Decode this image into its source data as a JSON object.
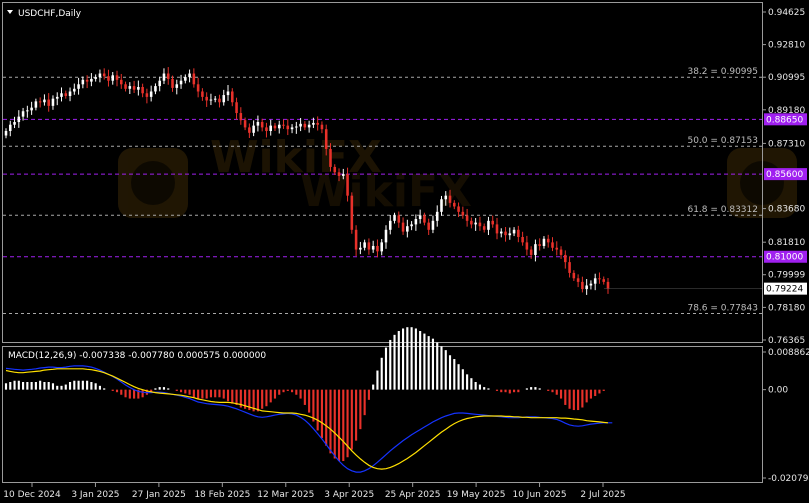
{
  "window": {
    "title": "USDCHF,Daily",
    "watermark_text": "WikiFX"
  },
  "colors": {
    "background": "#000000",
    "frame": "#9a9a9a",
    "bull": "#ffffff",
    "bear": "#e8312a",
    "fib_line": "#a8a8a8",
    "level_line": "#a020f0",
    "macd_signal": "#ffe000",
    "macd_line": "#1533ff",
    "hist_pos": "#ffffff",
    "hist_neg": "#e8312a"
  },
  "chart_data": [
    {
      "type": "candlestick",
      "symbol": "USDCHF",
      "timeframe": "Daily",
      "title": "USDCHF,Daily",
      "ylim": [
        0.76365,
        0.94625
      ],
      "y_ticks": [
        "0.94625",
        "0.92810",
        "0.90995",
        "0.89180",
        "0.88650",
        "0.87310",
        "0.85600",
        "0.83680",
        "0.81810",
        "0.81000",
        "0.79999",
        "0.79224",
        "0.78180",
        "0.76365"
      ],
      "x_ticks": [
        "10 Dec 2024",
        "3 Jan 2025",
        "27 Jan 2025",
        "18 Feb 2025",
        "12 Mar 2025",
        "3 Apr 2025",
        "25 Apr 2025",
        "19 May 2025",
        "10 Jun 2025",
        "2 Jul 2025"
      ],
      "fibonacci": [
        {
          "label": "38.2 = 0.90995",
          "value": 0.90995
        },
        {
          "label": "50.0 = 0.87153",
          "value": 0.87153
        },
        {
          "label": "61.8 = 0.83312",
          "value": 0.83312
        },
        {
          "label": "78.6 = 0.77843",
          "value": 0.77843
        }
      ],
      "levels": [
        {
          "label": "0.88650",
          "value": 0.8865
        },
        {
          "label": "0.85600",
          "value": 0.856
        },
        {
          "label": "0.81000",
          "value": 0.81
        }
      ],
      "last_price": {
        "label": "0.79224",
        "value": 0.79224
      },
      "closes": [
        0.88,
        0.8835,
        0.885,
        0.888,
        0.891,
        0.8915,
        0.893,
        0.8965,
        0.896,
        0.8975,
        0.894,
        0.898,
        0.899,
        0.901,
        0.8995,
        0.902,
        0.9035,
        0.906,
        0.9085,
        0.9075,
        0.909,
        0.91,
        0.912,
        0.9105,
        0.908,
        0.911,
        0.9085,
        0.906,
        0.9035,
        0.905,
        0.903,
        0.9045,
        0.901,
        0.899,
        0.902,
        0.905,
        0.908,
        0.912,
        0.909,
        0.904,
        0.906,
        0.908,
        0.91,
        0.912,
        0.906,
        0.902,
        0.899,
        0.897,
        0.8975,
        0.898,
        0.896,
        0.9,
        0.902,
        0.896,
        0.89,
        0.886,
        0.882,
        0.879,
        0.883,
        0.885,
        0.882,
        0.88,
        0.883,
        0.8815,
        0.8835,
        0.883,
        0.881,
        0.882,
        0.8825,
        0.884,
        0.882,
        0.8835,
        0.8845,
        0.8835,
        0.881,
        0.87,
        0.86,
        0.857,
        0.855,
        0.856,
        0.844,
        0.825,
        0.814,
        0.815,
        0.818,
        0.814,
        0.816,
        0.813,
        0.818,
        0.825,
        0.83,
        0.833,
        0.829,
        0.824,
        0.827,
        0.828,
        0.831,
        0.833,
        0.829,
        0.825,
        0.83,
        0.835,
        0.842,
        0.844,
        0.84,
        0.838,
        0.835,
        0.833,
        0.83,
        0.828,
        0.829,
        0.827,
        0.825,
        0.83,
        0.828,
        0.823,
        0.824,
        0.822,
        0.823,
        0.825,
        0.821,
        0.818,
        0.814,
        0.811,
        0.817,
        0.816,
        0.82,
        0.818,
        0.815,
        0.814,
        0.811,
        0.807,
        0.801,
        0.798,
        0.796,
        0.792,
        0.794,
        0.795,
        0.798,
        0.7975,
        0.796,
        0.7922
      ],
      "macd_header": "MACD(12,26,9) -0.007338 -0.007780 0.000575 0.000000",
      "macd_ylim": [
        -0.020794,
        0.008862
      ],
      "macd_y_ticks": [
        "0.008862",
        "0.00",
        "-0.020794"
      ],
      "macd_signal": [
        0.0045,
        0.0043,
        0.0041,
        0.004,
        0.004,
        0.0041,
        0.0042,
        0.0043,
        0.0044,
        0.0046,
        0.0047,
        0.0048,
        0.0049,
        0.0049,
        0.0049,
        0.0049,
        0.0049,
        0.0049,
        0.0049,
        0.0048,
        0.0047,
        0.0045,
        0.0043,
        0.004,
        0.0036,
        0.0032,
        0.0027,
        0.0022,
        0.0017,
        0.0012,
        0.0007,
        0.0003,
        0.0,
        -0.0003,
        -0.0005,
        -0.0007,
        -0.0008,
        -0.0009,
        -0.001,
        -0.0011,
        -0.0012,
        -0.0013,
        -0.0015,
        -0.0017,
        -0.0019,
        -0.0022,
        -0.0024,
        -0.0026,
        -0.0028,
        -0.0029,
        -0.003,
        -0.003,
        -0.003,
        -0.0031,
        -0.0033,
        -0.0035,
        -0.0038,
        -0.0041,
        -0.0044,
        -0.0047,
        -0.005,
        -0.0051,
        -0.0052,
        -0.0053,
        -0.0054,
        -0.0055,
        -0.0055,
        -0.0055,
        -0.0056,
        -0.0058,
        -0.006,
        -0.0063,
        -0.0067,
        -0.0072,
        -0.0078,
        -0.0085,
        -0.0093,
        -0.0102,
        -0.0112,
        -0.0122,
        -0.0133,
        -0.0144,
        -0.0154,
        -0.0163,
        -0.0171,
        -0.0178,
        -0.0183,
        -0.0186,
        -0.0187,
        -0.0186,
        -0.0183,
        -0.0179,
        -0.0174,
        -0.0168,
        -0.0162,
        -0.0155,
        -0.0148,
        -0.014,
        -0.0132,
        -0.0124,
        -0.0116,
        -0.0108,
        -0.01,
        -0.0093,
        -0.0086,
        -0.008,
        -0.0075,
        -0.0071,
        -0.0068,
        -0.0066,
        -0.0064,
        -0.0063,
        -0.0062,
        -0.0062,
        -0.0062,
        -0.0062,
        -0.0062,
        -0.0063,
        -0.0063,
        -0.0064,
        -0.0064,
        -0.0065,
        -0.0065,
        -0.0066,
        -0.0066,
        -0.0066,
        -0.0066,
        -0.0066,
        -0.0066,
        -0.0066,
        -0.0067,
        -0.0067,
        -0.0068,
        -0.0069,
        -0.007,
        -0.0071,
        -0.0073,
        -0.0074,
        -0.0075,
        -0.0076,
        -0.0077,
        -0.0078
      ],
      "macd_line": [
        0.005,
        0.0049,
        0.0048,
        0.0047,
        0.0046,
        0.0047,
        0.0048,
        0.0049,
        0.0051,
        0.0052,
        0.0053,
        0.0053,
        0.0052,
        0.0052,
        0.0053,
        0.0055,
        0.0056,
        0.0056,
        0.0056,
        0.0055,
        0.0053,
        0.005,
        0.0046,
        0.0041,
        0.0036,
        0.0031,
        0.0025,
        0.0018,
        0.0011,
        0.0005,
        0.0,
        -0.0004,
        -0.0006,
        -0.0007,
        -0.0007,
        -0.0006,
        -0.0006,
        -0.0007,
        -0.0009,
        -0.0011,
        -0.0013,
        -0.0015,
        -0.0018,
        -0.0021,
        -0.0025,
        -0.0029,
        -0.0031,
        -0.0033,
        -0.0034,
        -0.0035,
        -0.0036,
        -0.0037,
        -0.0039,
        -0.0042,
        -0.0045,
        -0.0049,
        -0.0053,
        -0.0057,
        -0.0061,
        -0.0064,
        -0.0065,
        -0.0064,
        -0.0062,
        -0.006,
        -0.0058,
        -0.0057,
        -0.0056,
        -0.0057,
        -0.006,
        -0.0065,
        -0.0072,
        -0.0081,
        -0.0092,
        -0.0104,
        -0.0116,
        -0.0129,
        -0.0143,
        -0.0156,
        -0.0168,
        -0.0178,
        -0.0186,
        -0.0191,
        -0.0194,
        -0.0194,
        -0.0191,
        -0.0186,
        -0.0179,
        -0.0171,
        -0.0162,
        -0.0153,
        -0.0144,
        -0.0136,
        -0.0128,
        -0.012,
        -0.0113,
        -0.0106,
        -0.01,
        -0.0094,
        -0.0088,
        -0.0082,
        -0.0076,
        -0.0071,
        -0.0066,
        -0.0062,
        -0.0059,
        -0.0056,
        -0.0055,
        -0.0055,
        -0.0056,
        -0.0057,
        -0.0058,
        -0.0059,
        -0.006,
        -0.0061,
        -0.0062,
        -0.0063,
        -0.0064,
        -0.0065,
        -0.0066,
        -0.0066,
        -0.0066,
        -0.0065,
        -0.0064,
        -0.0064,
        -0.0064,
        -0.0065,
        -0.0066,
        -0.0067,
        -0.0068,
        -0.007,
        -0.0074,
        -0.0079,
        -0.0083,
        -0.0085,
        -0.0086,
        -0.0085,
        -0.0083,
        -0.0081,
        -0.008,
        -0.0079,
        -0.0078,
        -0.0078,
        -0.0078
      ]
    }
  ]
}
